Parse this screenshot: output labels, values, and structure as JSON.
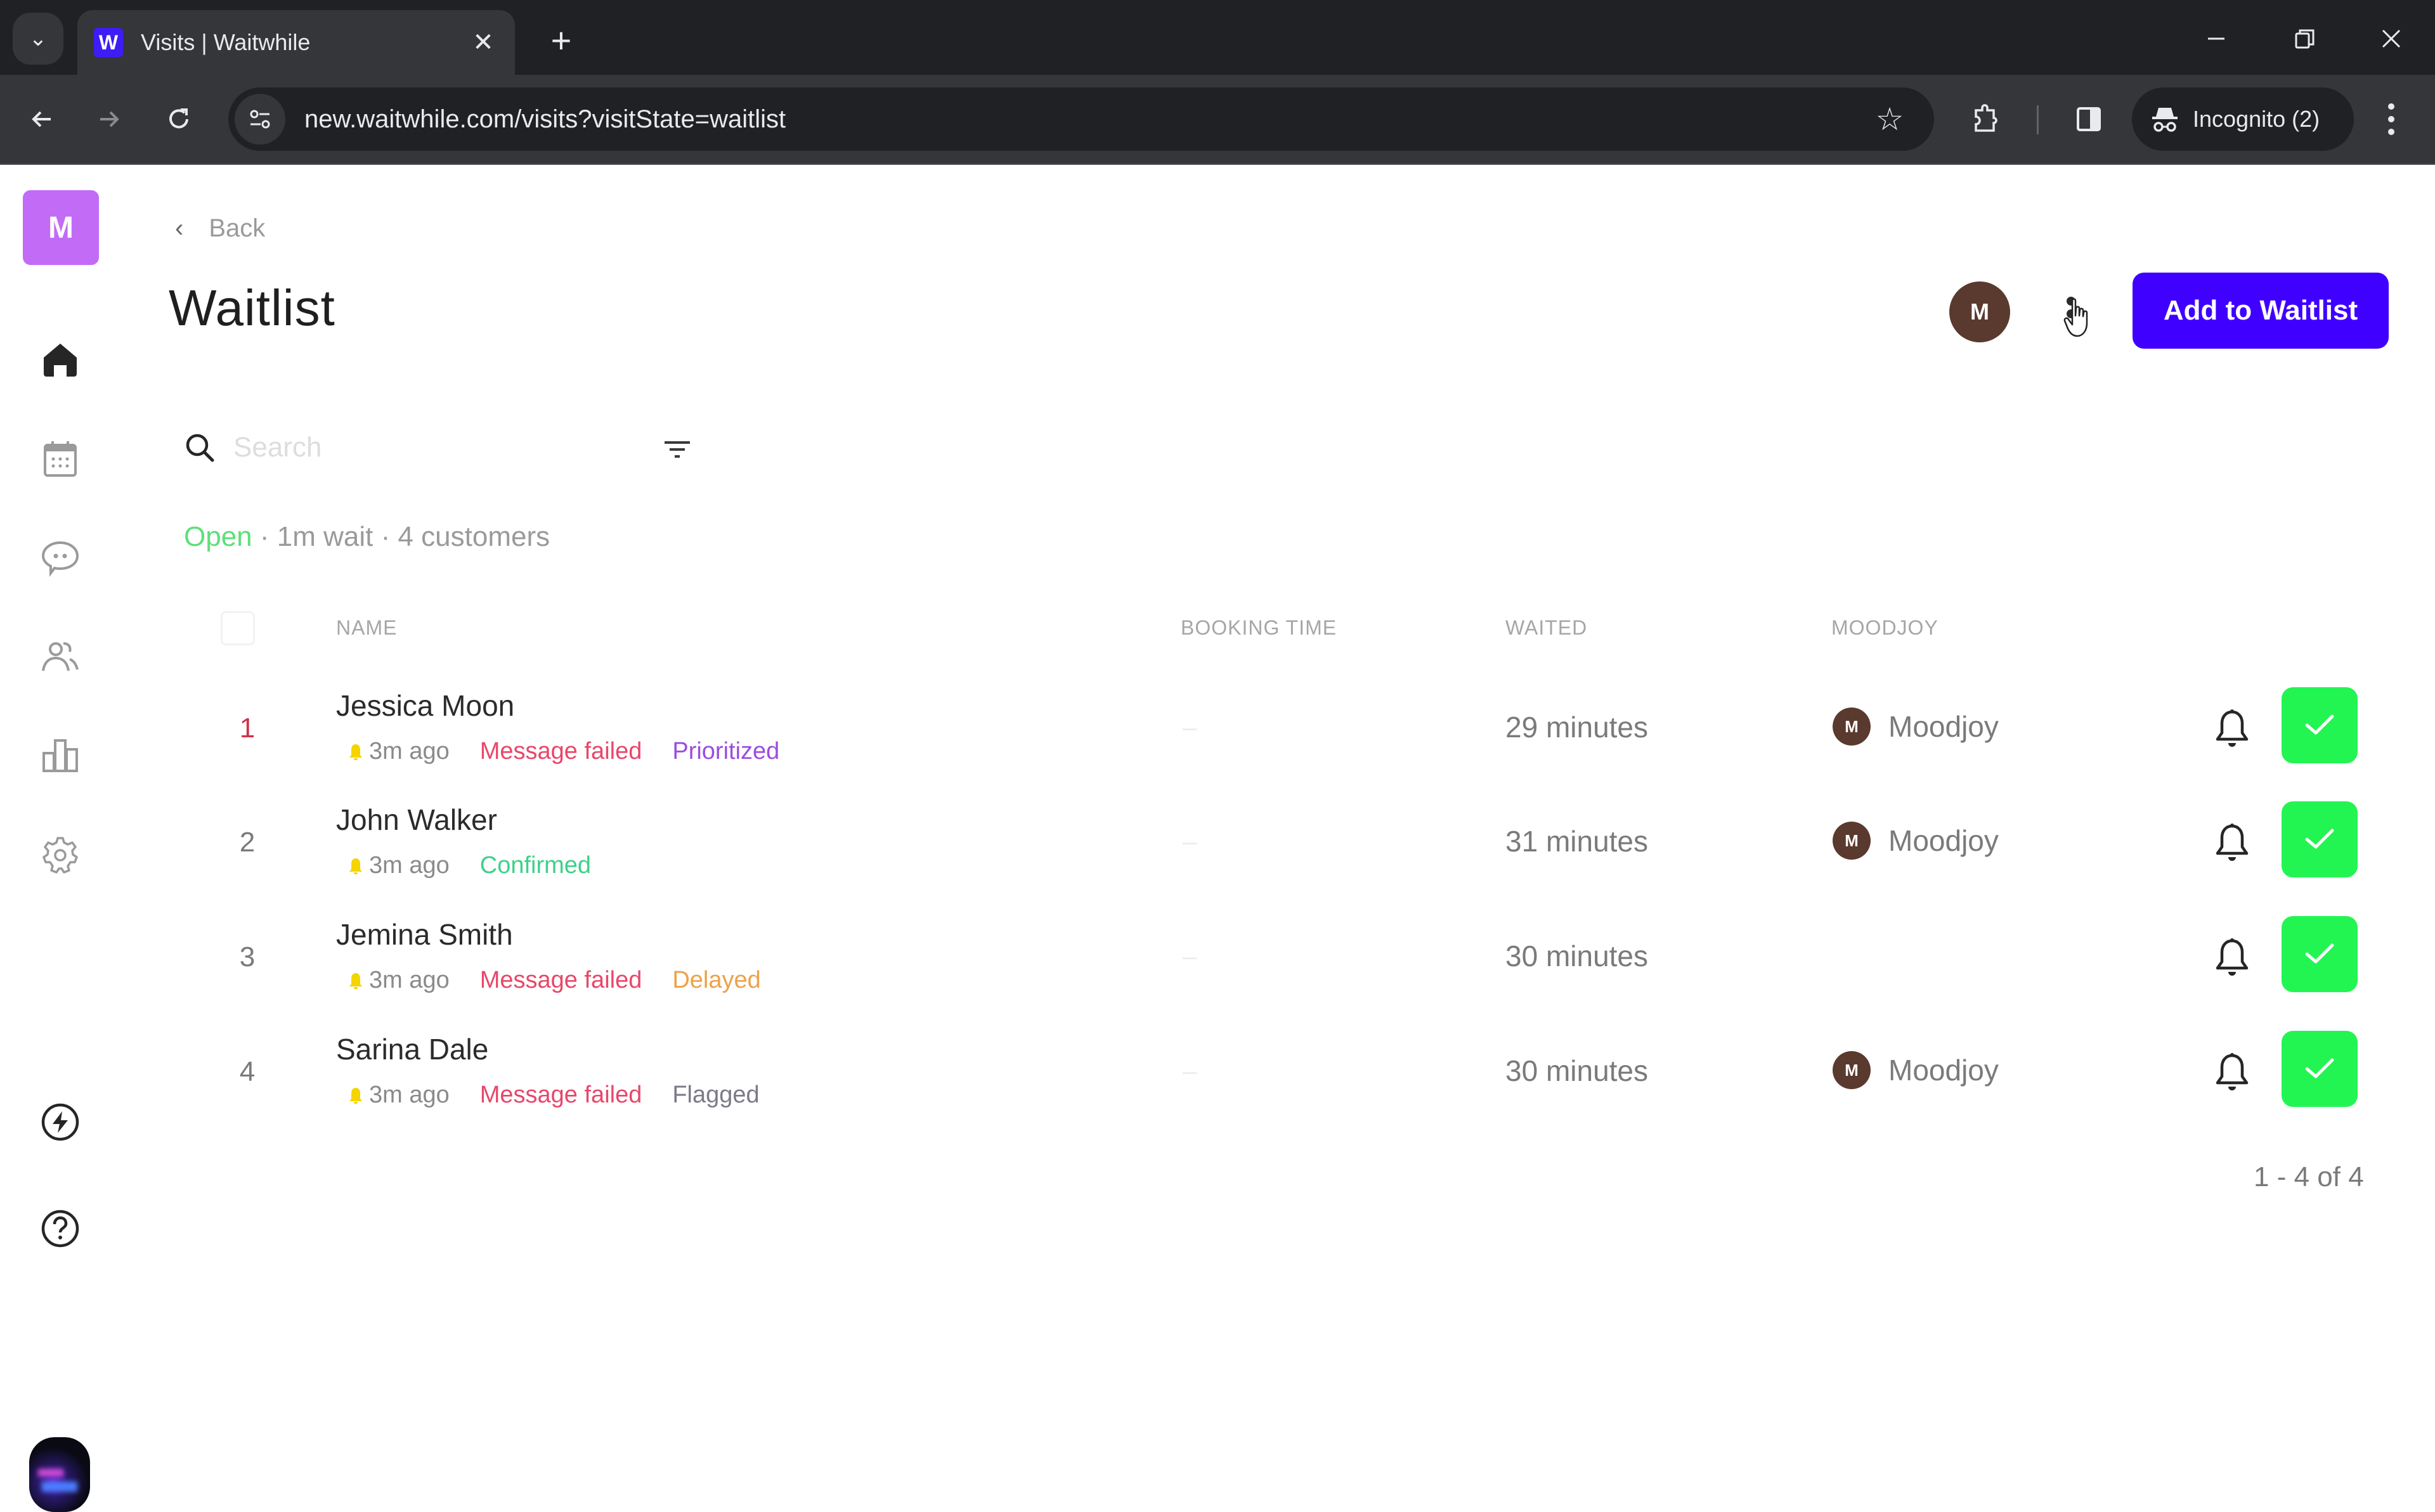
{
  "browser": {
    "tab_title": "Visits | Waitwhile",
    "tab_favicon_letter": "W",
    "url": "new.waitwhile.com/visits?visitState=waitlist",
    "profile_label": "Incognito (2)",
    "icons": {
      "tab_search": "chevron-down-icon",
      "close_tab": "close-icon",
      "new_tab": "plus-icon",
      "minimize": "minimize-icon",
      "restore": "restore-icon",
      "close_window": "close-icon",
      "back": "arrow-left-icon",
      "forward": "arrow-right-icon",
      "reload": "reload-icon",
      "site_info": "tune-icon",
      "bookmark": "star-icon",
      "extensions": "puzzle-icon",
      "side_panel": "side-panel-icon",
      "incognito": "incognito-icon",
      "menu": "more-vertical-icon"
    },
    "glyphs": {
      "tab_search": "⌄",
      "close_tab": "✕",
      "new_tab": "+",
      "minimize": "—",
      "close_window": "✕",
      "back": "←",
      "forward": "→",
      "reload": "↻",
      "bookmark": "☆"
    }
  },
  "sidebar": {
    "org_initial": "M",
    "nav": [
      {
        "id": "home",
        "icon": "home-icon",
        "active": true
      },
      {
        "id": "calendar",
        "icon": "calendar-icon",
        "active": false
      },
      {
        "id": "messages",
        "icon": "chat-icon",
        "active": false
      },
      {
        "id": "customers",
        "icon": "users-icon",
        "active": false
      },
      {
        "id": "analytics",
        "icon": "bar-chart-icon",
        "active": false
      },
      {
        "id": "settings",
        "icon": "gear-icon",
        "active": false
      }
    ],
    "bottom": [
      {
        "id": "whats-new",
        "icon": "lightning-icon"
      },
      {
        "id": "help",
        "icon": "help-icon"
      },
      {
        "id": "user-profile",
        "icon": "user-photo"
      }
    ]
  },
  "header": {
    "back_label": "Back",
    "back_glyph": "‹",
    "title": "Waitlist",
    "user_initial": "M",
    "add_button_label": "Add to Waitlist"
  },
  "search": {
    "placeholder": "Search",
    "value": ""
  },
  "status": {
    "state": "Open",
    "separator": " · ",
    "wait": "1m wait",
    "customers": "4 customers"
  },
  "table": {
    "columns": [
      "NAME",
      "BOOKING TIME",
      "WAITED",
      "MOODJOY"
    ],
    "rows": [
      {
        "position": "1",
        "name": "Jessica Moon",
        "ago": "3m ago",
        "tags": [
          {
            "label": "Message failed",
            "color": "#e8476a"
          },
          {
            "label": "Prioritized",
            "color": "#9b4de0"
          }
        ],
        "booking_time": "–",
        "waited": "29 minutes",
        "provider_initial": "M",
        "provider": "Moodjoy"
      },
      {
        "position": "2",
        "name": "John Walker",
        "ago": "3m ago",
        "tags": [
          {
            "label": "Confirmed",
            "color": "#3fd08a"
          }
        ],
        "booking_time": "–",
        "waited": "31 minutes",
        "provider_initial": "M",
        "provider": "Moodjoy"
      },
      {
        "position": "3",
        "name": "Jemina Smith",
        "ago": "3m ago",
        "tags": [
          {
            "label": "Message failed",
            "color": "#e8476a"
          },
          {
            "label": "Delayed",
            "color": "#eca24a"
          }
        ],
        "booking_time": "–",
        "waited": "30 minutes",
        "provider_initial": "",
        "provider": ""
      },
      {
        "position": "4",
        "name": "Sarina Dale",
        "ago": "3m ago",
        "tags": [
          {
            "label": "Message failed",
            "color": "#e8476a"
          },
          {
            "label": "Flagged",
            "color": "#7a7a8a"
          }
        ],
        "booking_time": "–",
        "waited": "30 minutes",
        "provider_initial": "M",
        "provider": "Moodjoy"
      }
    ]
  },
  "pagination": {
    "label": "1 - 4 of 4"
  },
  "colors": {
    "brand": "#3f00ff",
    "org_logo": "#c26bf7",
    "serve_button": "#22f552",
    "open_status": "#5ce07a",
    "avatar": "#5a3a2e"
  }
}
